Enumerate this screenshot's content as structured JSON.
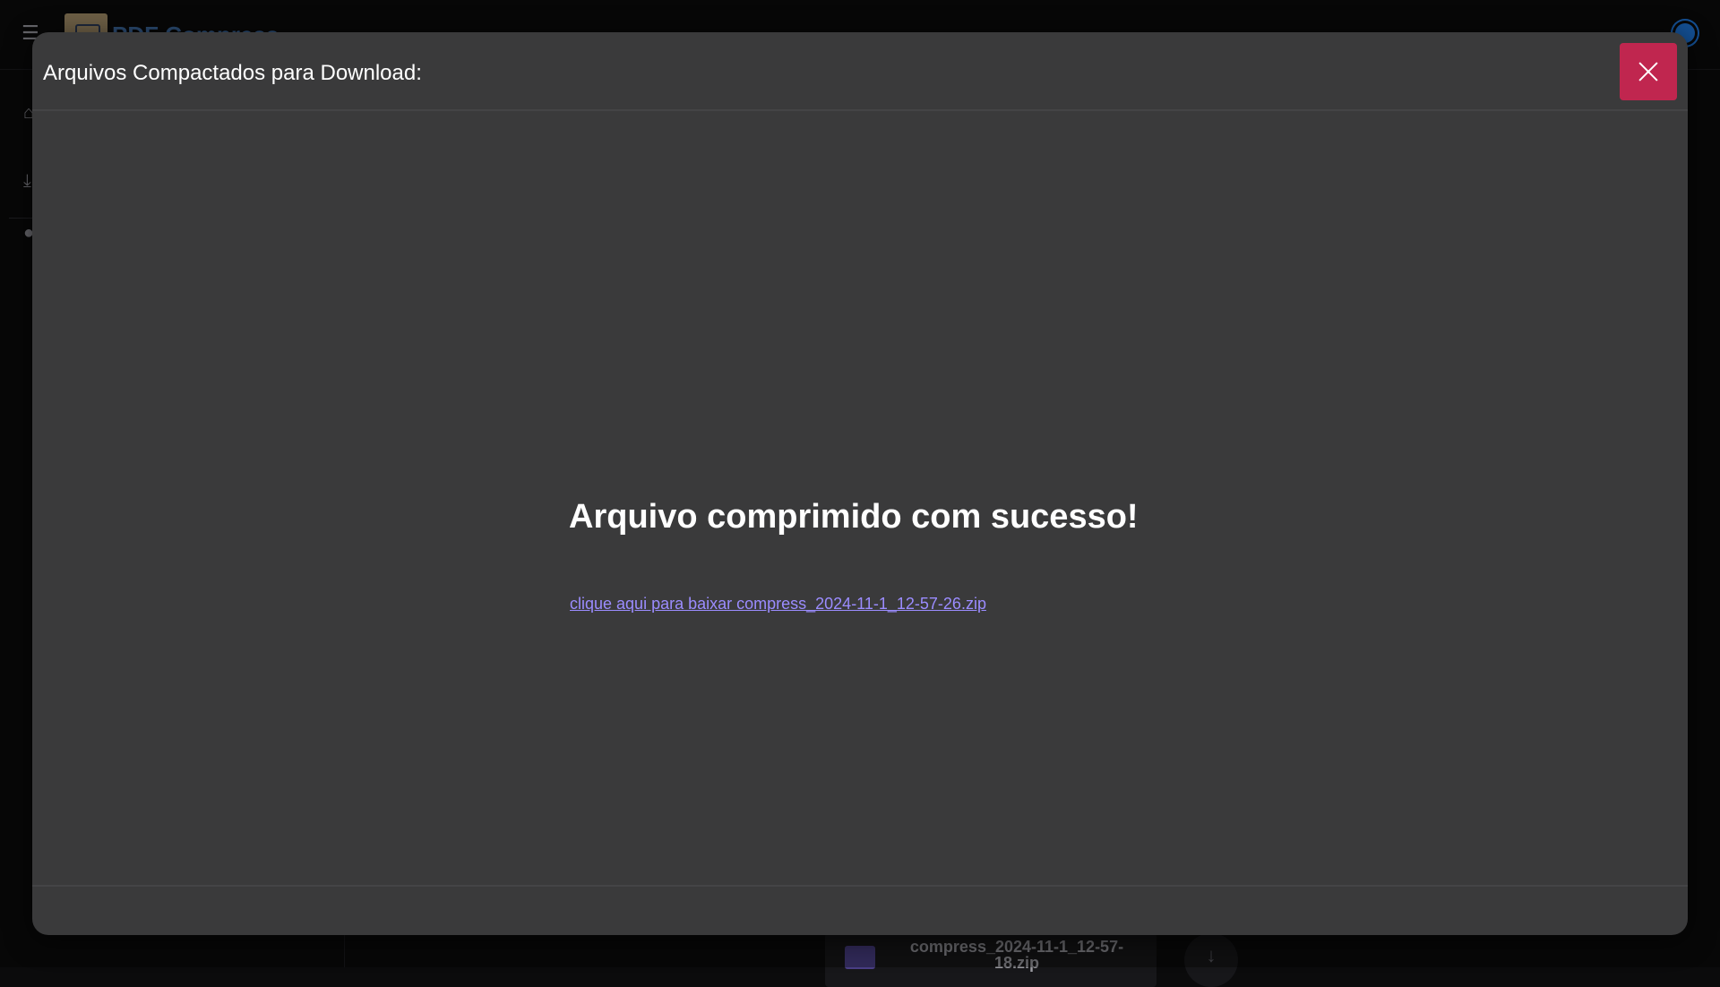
{
  "app": {
    "brand": "PDF Compress",
    "menu_icon": "menu-collapse-icon",
    "theme_icon": "sun-icon",
    "sidebar": {
      "icons": [
        "home-icon",
        "download-icon",
        "user-icon"
      ]
    },
    "recent_file": {
      "name": "compress_2024-11-1_12-57-18.zip",
      "icon": "folder-icon",
      "action_icon": "download-arrow-icon"
    }
  },
  "modal": {
    "title": "Arquivos Compactados para Download:",
    "close_icon": "close-icon",
    "close_color": "#c0264f",
    "success_message": "Arquivo comprimido com sucesso!",
    "download_link_text": "clique aqui para baixar compress_2024-11-1_12-57-26.zip"
  }
}
